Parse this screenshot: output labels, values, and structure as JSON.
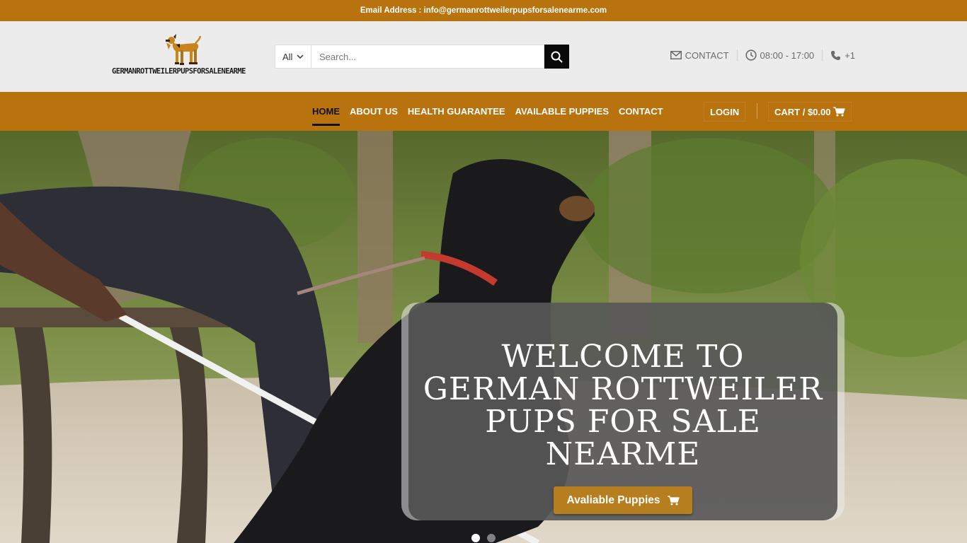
{
  "topbar": {
    "text": "Email Address : info@germanrottweilerpupsforsalenearme.com"
  },
  "logo": {
    "text": "GERMANROTTWEILERPUPSFORSALENEARME"
  },
  "search": {
    "category": "All",
    "placeholder": "Search..."
  },
  "header_right": {
    "contact": "CONTACT",
    "hours": "08:00 - 17:00",
    "phone": "+1"
  },
  "nav": {
    "items": [
      "HOME",
      "ABOUT US",
      "HEALTH GUARANTEE",
      "AVAILABLE PUPPIES",
      "CONTACT"
    ],
    "active": "HOME",
    "login": "LOGIN",
    "cart": "CART / $0.00"
  },
  "hero": {
    "title": "WELCOME TO GERMAN ROTTWEILER PUPS FOR SALE NEARME",
    "button": "Avaliable Puppies",
    "slides": 2,
    "active_slide": 1
  },
  "colors": {
    "brand": "#b8730f",
    "button": "#b77e20",
    "search_button": "#0a0a0a"
  },
  "icons": [
    "dog-logo-icon",
    "chevron-down-icon",
    "search-icon",
    "envelope-icon",
    "clock-icon",
    "phone-icon",
    "cart-icon"
  ]
}
